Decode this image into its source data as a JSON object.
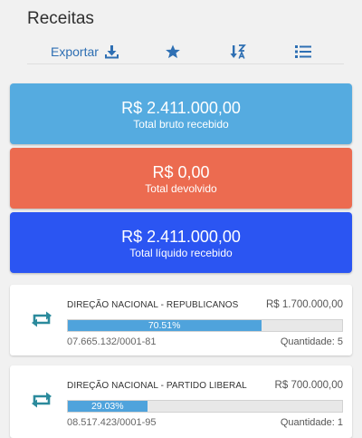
{
  "header": {
    "title": "Receitas"
  },
  "toolbar": {
    "export_label": "Exportar",
    "icons": [
      "download-icon",
      "star-icon",
      "sort-alpha-icon",
      "list-icon"
    ]
  },
  "summary": {
    "bruto": {
      "amount": "R$ 2.411.000,00",
      "caption": "Total bruto recebido",
      "color": "#55abe0"
    },
    "devolvido": {
      "amount": "R$ 0,00",
      "caption": "Total devolvido",
      "color": "#ec6b50"
    },
    "liquido": {
      "amount": "R$ 2.411.000,00",
      "caption": "Total líquido recebido",
      "color": "#2b55f2"
    }
  },
  "receipts": [
    {
      "name": "DIREÇÃO NACIONAL - REPUBLICANOS",
      "value": "R$ 1.700.000,00",
      "percent_label": "70.51%",
      "percent": 70.51,
      "doc": "07.665.132/0001-81",
      "quantity": "Quantidade: 5"
    },
    {
      "name": "DIREÇÃO NACIONAL - PARTIDO LIBERAL",
      "value": "R$ 700.000,00",
      "percent_label": "29.03%",
      "percent": 29.03,
      "doc": "08.517.423/0001-95",
      "quantity": "Quantidade: 1"
    }
  ],
  "colors": {
    "accent": "#2e6fb3",
    "bar_fill": "#4fa3dc",
    "swap_icon": "#2b8a9c"
  }
}
